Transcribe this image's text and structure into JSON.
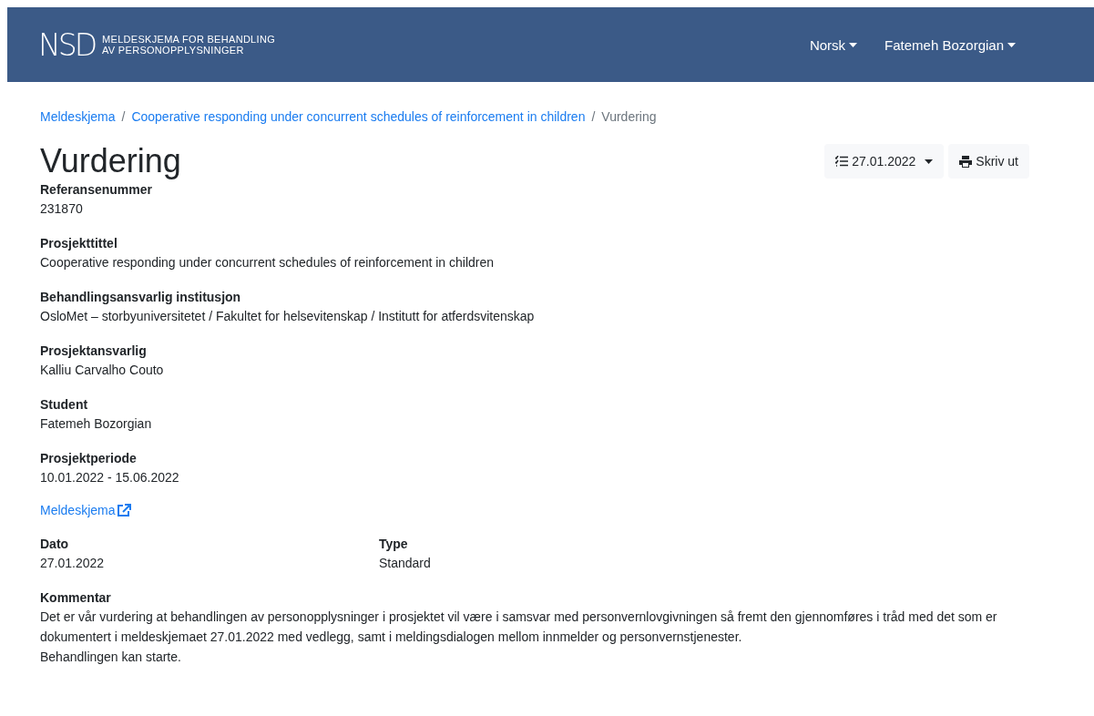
{
  "header": {
    "logo": "NSD",
    "subtitle_lines": [
      "MELDESKJEMA FOR BEHANDLING",
      "AV PERSONOPPLYSNINGER"
    ],
    "menus": [
      "Norsk",
      "Fatemeh Bozorgian"
    ]
  },
  "breadcrumb_separator": "/",
  "breadcrumb": [
    {
      "label": "Meldeskjema",
      "kind": "link"
    },
    {
      "label": "Cooperative responding under concurrent schedules of reinforcement in children",
      "kind": "link"
    },
    {
      "label": "Vurdering",
      "kind": "current"
    }
  ],
  "title": "Vurdering",
  "actions": {
    "version": "27.01.2022",
    "print": "Skriv ut"
  },
  "fields": [
    {
      "label": "Referansenummer",
      "value": "231870"
    },
    {
      "label": "Prosjekttittel",
      "value": "Cooperative responding under concurrent schedules of reinforcement in children"
    },
    {
      "label": "Behandlingsansvarlig institusjon",
      "value": "OsloMet – storbyuniversitetet / Fakultet for helsevitenskap / Institutt for atferdsvitenskap"
    },
    {
      "label": "Prosjektansvarlig",
      "value": "Kalliu Carvalho Couto"
    },
    {
      "label": "Student",
      "value": "Fatemeh Bozorgian"
    },
    {
      "label": "Prosjektperiode",
      "value": "10.01.2022 - 15.06.2022"
    }
  ],
  "form_link": "Meldeskjema",
  "pair": [
    {
      "label": "Dato",
      "value": "27.01.2022"
    },
    {
      "label": "Type",
      "value": "Standard"
    }
  ],
  "comment": {
    "label": "Kommentar",
    "lines": [
      "Det er vår vurdering at behandlingen av personopplysninger i prosjektet vil være i samsvar med personvernlovgivningen så fremt den gjennomføres i tråd med det som er dokumentert i meldeskjemaet 27.01.2022 med vedlegg, samt i meldingsdialogen mellom innmelder og personvernstjenester.",
      "Behandlingen kan starte."
    ]
  }
}
